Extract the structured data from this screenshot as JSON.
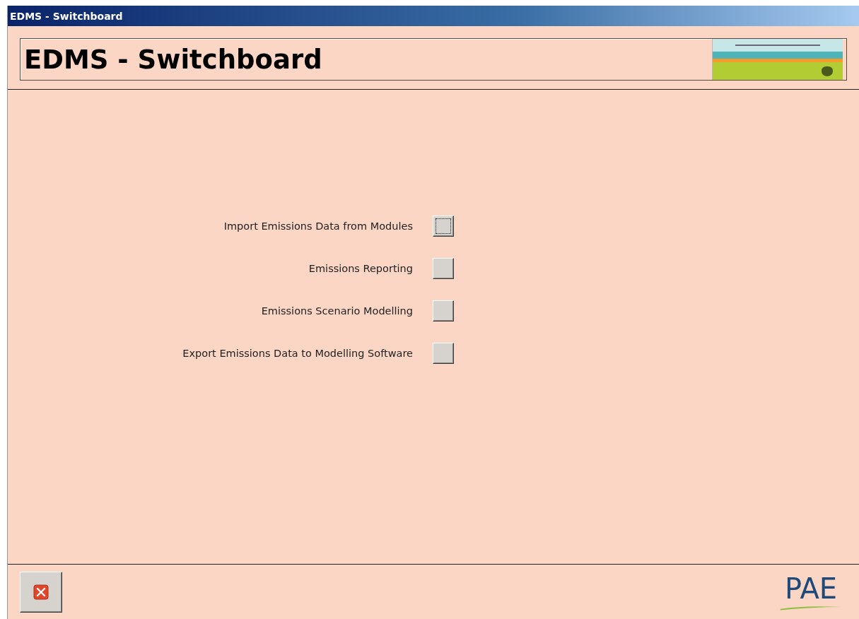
{
  "window": {
    "title": "EDMS - Switchboard"
  },
  "header": {
    "title": "EDMS - Switchboard"
  },
  "menu_items": [
    {
      "label": "Import Emissions Data from Modules",
      "focused": true
    },
    {
      "label": "Emissions Reporting",
      "focused": false
    },
    {
      "label": "Emissions Scenario Modelling",
      "focused": false
    },
    {
      "label": "Export Emissions Data to Modelling Software",
      "focused": false
    }
  ],
  "footer": {
    "brand": "PAE"
  }
}
